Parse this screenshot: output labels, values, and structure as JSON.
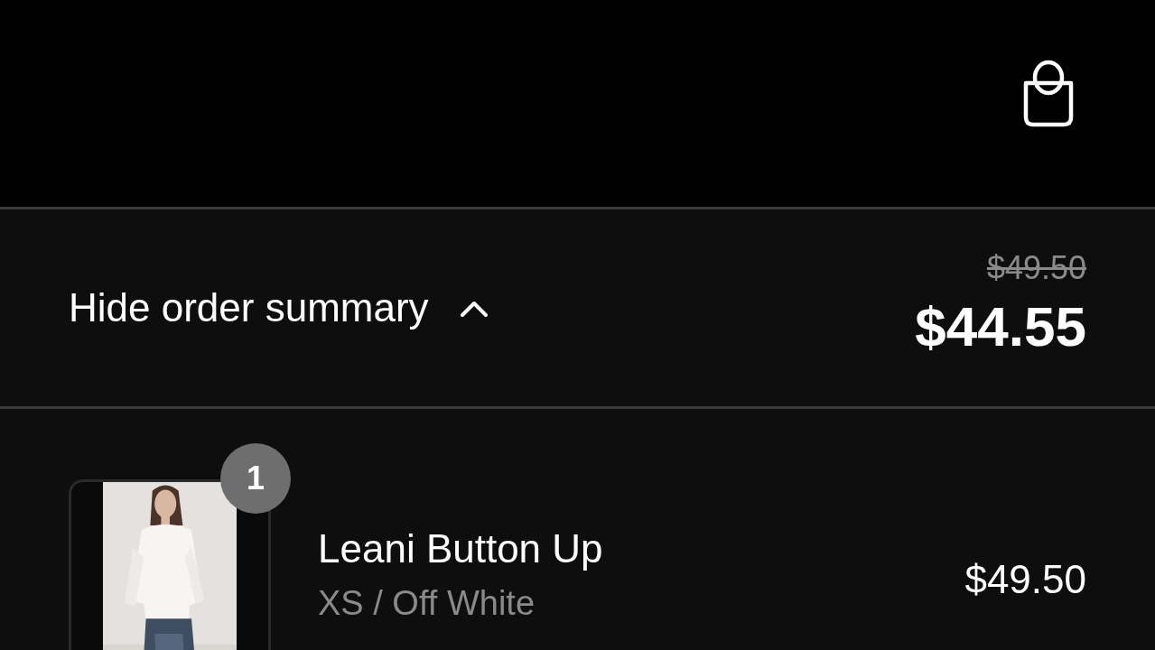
{
  "summary": {
    "toggle_label": "Hide order summary",
    "expanded": true,
    "original_total": "$49.50",
    "total": "$44.55"
  },
  "items": [
    {
      "name": "Leani Button Up",
      "variant": "XS / Off White",
      "price": "$49.50",
      "quantity": "1"
    }
  ]
}
